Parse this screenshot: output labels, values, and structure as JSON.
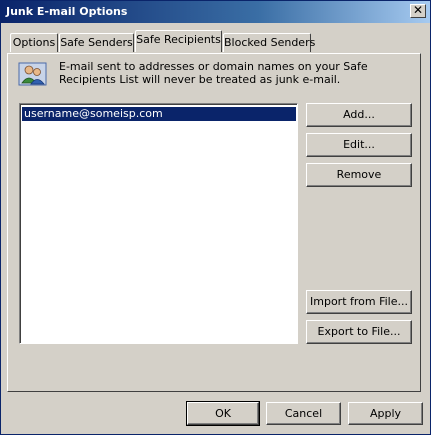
{
  "window": {
    "title": "Junk E-mail Options",
    "close_glyph": "✕"
  },
  "tabs": [
    {
      "label": "Options"
    },
    {
      "label": "Safe Senders"
    },
    {
      "label": "Safe Recipients",
      "active": true
    },
    {
      "label": "Blocked Senders"
    }
  ],
  "info": {
    "icon": "people-icon",
    "text": "E-mail sent to addresses or domain names on your Safe Recipients List will never be treated as junk e-mail."
  },
  "list": {
    "items": [
      "username@someisp.com"
    ],
    "selected_index": 0
  },
  "side_buttons": {
    "add": "Add...",
    "edit": "Edit...",
    "remove": "Remove",
    "import": "Import from File...",
    "export": "Export to File..."
  },
  "footer_buttons": {
    "ok": "OK",
    "cancel": "Cancel",
    "apply": "Apply"
  },
  "colors": {
    "title_bar": "#0a246a",
    "selection": "#0a246a",
    "face": "#d4d0c8"
  }
}
